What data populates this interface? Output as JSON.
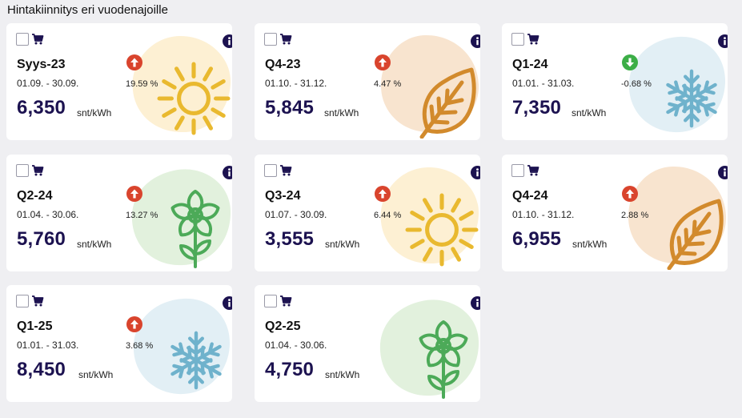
{
  "page": {
    "title": "Hintakiinnitys eri vuodenajoille"
  },
  "cards": [
    {
      "name": "Syys-23",
      "dates": "01.09. - 30.09.",
      "price": "6,350",
      "unit": "snt/kWh",
      "change": "19.59 %",
      "direction": "up",
      "season": "sun"
    },
    {
      "name": "Q4-23",
      "dates": "01.10. - 31.12.",
      "price": "5,845",
      "unit": "snt/kWh",
      "change": "4.47 %",
      "direction": "up",
      "season": "leaf"
    },
    {
      "name": "Q1-24",
      "dates": "01.01. - 31.03.",
      "price": "7,350",
      "unit": "snt/kWh",
      "change": "-0.68 %",
      "direction": "down",
      "season": "snow"
    },
    {
      "name": "Q2-24",
      "dates": "01.04. - 30.06.",
      "price": "5,760",
      "unit": "snt/kWh",
      "change": "13.27 %",
      "direction": "up",
      "season": "flower"
    },
    {
      "name": "Q3-24",
      "dates": "01.07. - 30.09.",
      "price": "3,555",
      "unit": "snt/kWh",
      "change": "6.44 %",
      "direction": "up",
      "season": "sun"
    },
    {
      "name": "Q4-24",
      "dates": "01.10. - 31.12.",
      "price": "6,955",
      "unit": "snt/kWh",
      "change": "2.88 %",
      "direction": "up",
      "season": "leaf"
    },
    {
      "name": "Q1-25",
      "dates": "01.01. - 31.03.",
      "price": "8,450",
      "unit": "snt/kWh",
      "change": "3.68 %",
      "direction": "up",
      "season": "snow"
    },
    {
      "name": "Q2-25",
      "dates": "01.04. - 30.06.",
      "price": "4,750",
      "unit": "snt/kWh",
      "change": "",
      "direction": "none",
      "season": "flower"
    }
  ],
  "colors": {
    "price": "#1c1250",
    "up": "#d9442d",
    "down": "#3cae47",
    "sun_blob": "#fdf0d3",
    "sun_stroke": "#e9b92f",
    "leaf_blob": "#f8e4cf",
    "leaf_stroke": "#d28a2c",
    "snow_blob": "#e2eff5",
    "snow_stroke": "#6fb2cc",
    "flower_blob": "#e2f1dd",
    "flower_stroke": "#4caa58"
  }
}
